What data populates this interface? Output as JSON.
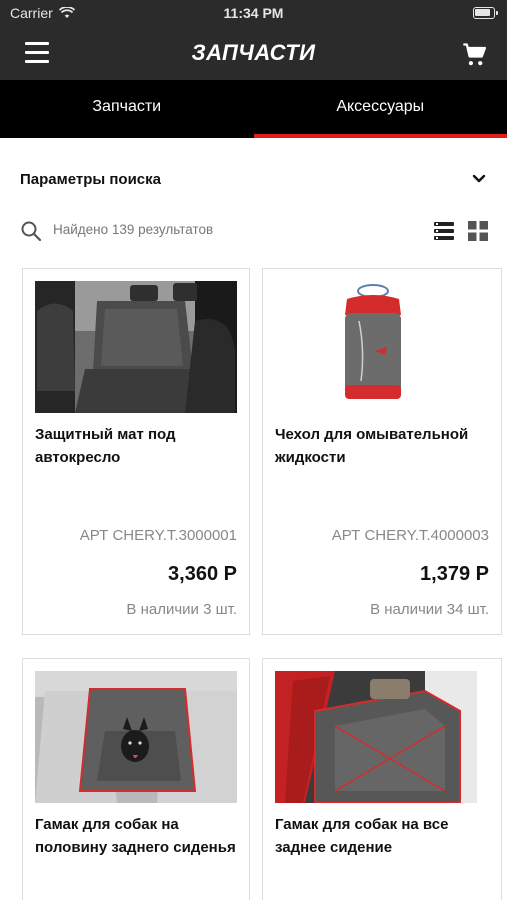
{
  "status_bar": {
    "carrier": "Carrier",
    "time": "11:34 PM"
  },
  "header": {
    "title": "ЗАПЧАСТИ"
  },
  "tabs": [
    {
      "label": "Запчасти",
      "active": false
    },
    {
      "label": "Аксессуары",
      "active": true
    }
  ],
  "filters": {
    "label": "Параметры поиска"
  },
  "results": {
    "text": "Найдено 139 результатов"
  },
  "colors": {
    "accent": "#e21b1b",
    "header_bg": "#2b2b2b",
    "tab_bg": "#000000"
  },
  "products": [
    {
      "title": "Защитный мат под автокресло",
      "sku": "АРТ CHERY.T.3000001",
      "price": "3,360 Р",
      "stock": "В наличии 3 шт."
    },
    {
      "title": "Чехол для омывательной жидкости",
      "sku": "АРТ CHERY.T.4000003",
      "price": "1,379 Р",
      "stock": "В наличии 34 шт."
    },
    {
      "title": "Гамак для собак на половину заднего сиденья",
      "sku": "",
      "price": "",
      "stock": ""
    },
    {
      "title": "Гамак для собак на все заднее сидение",
      "sku": "",
      "price": "",
      "stock": ""
    }
  ]
}
